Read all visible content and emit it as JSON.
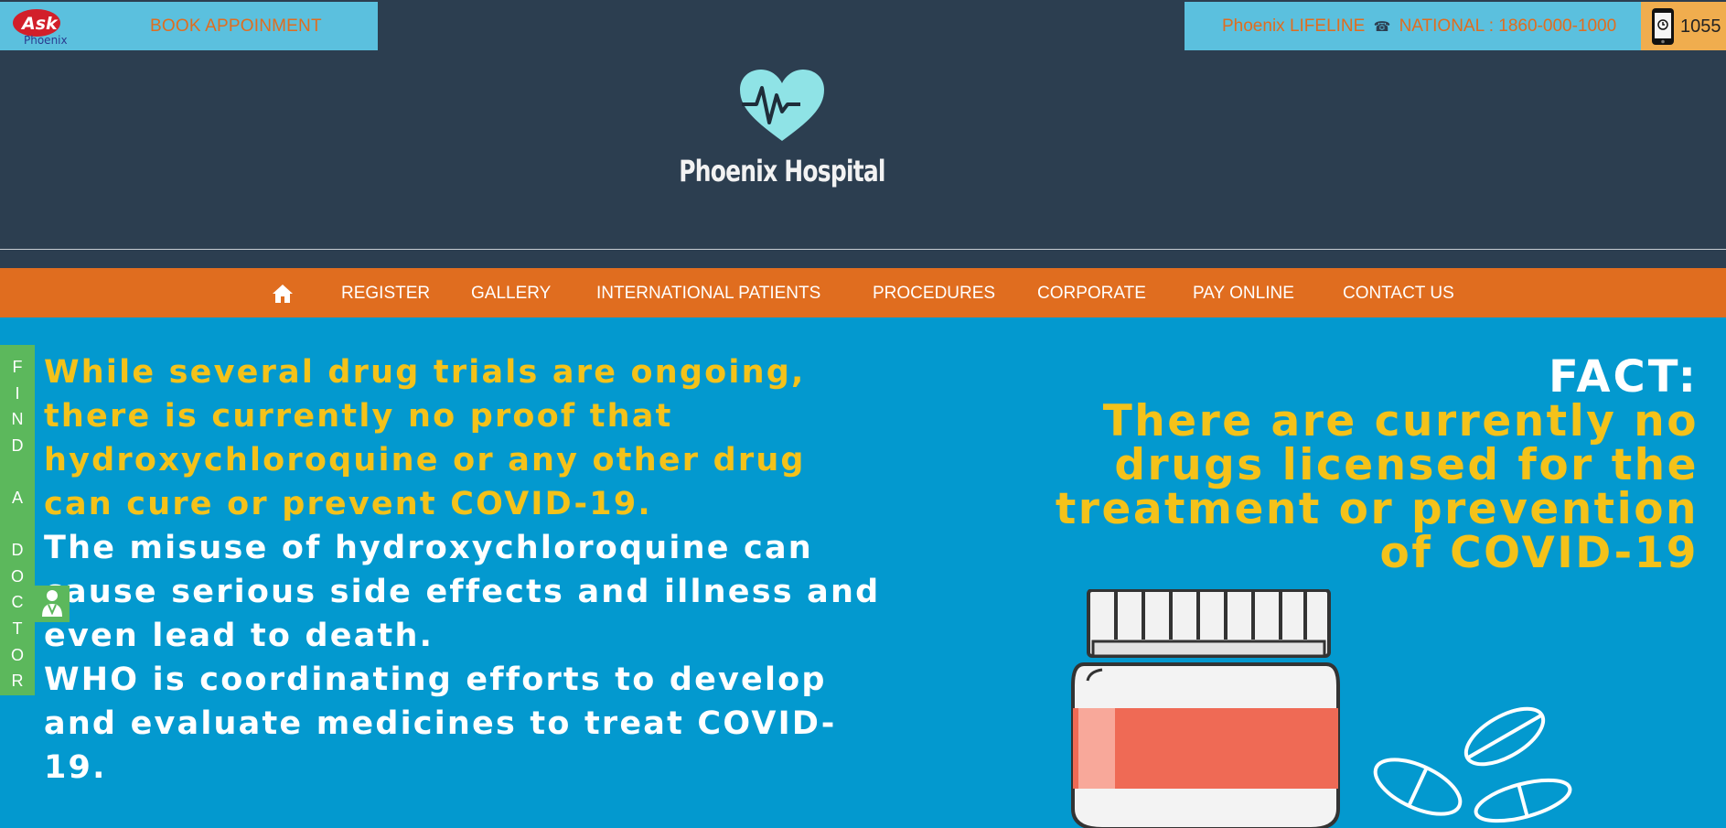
{
  "topbar": {
    "ask_logo_text": "Ask",
    "ask_logo_sub": "Phoenix",
    "book_label": "BOOK APPOINMENT",
    "lifeline_label": "Phoenix LIFELINE",
    "national_label": "NATIONAL : 1860-000-1000",
    "mobile_number": "1055"
  },
  "header": {
    "brand_name": "Phoenix Hospital"
  },
  "nav": {
    "items": [
      {
        "label": "REGISTER"
      },
      {
        "label": "GALLERY"
      },
      {
        "label": "INTERNATIONAL PATIENTS"
      },
      {
        "label": "PROCEDURES"
      },
      {
        "label": "CORPORATE"
      },
      {
        "label": "PAY ONLINE"
      },
      {
        "label": "CONTACT US"
      }
    ]
  },
  "find_doctor": {
    "letters": [
      "F",
      "I",
      "N",
      "D",
      "",
      "A",
      "",
      "D",
      "O",
      "C",
      "T",
      "O",
      "R"
    ]
  },
  "hero": {
    "left_lines_yellow": [
      "While several drug trials are ongoing,",
      "there is currently no proof that",
      "hydroxychloroquine or any other drug",
      "can cure or prevent COVID-19."
    ],
    "left_lines_white": [
      "The misuse of hydroxychloroquine can",
      "cause serious side effects and illness and",
      "even lead to death.",
      "WHO is coordinating efforts to develop",
      "and evaluate medicines to treat COVID-",
      "19."
    ],
    "fact_label": "FACT:",
    "fact_lines": [
      "There are currently no",
      "drugs licensed for the",
      "treatment or prevention",
      "of COVID-19"
    ]
  },
  "colors": {
    "header_bg": "#2c3e50",
    "topbar_bg": "#5bc0de",
    "accent_orange": "#e06d1f",
    "hero_bg": "#0399cf",
    "hero_yellow": "#f4c21a",
    "find_doctor_green": "#5cb85c"
  }
}
